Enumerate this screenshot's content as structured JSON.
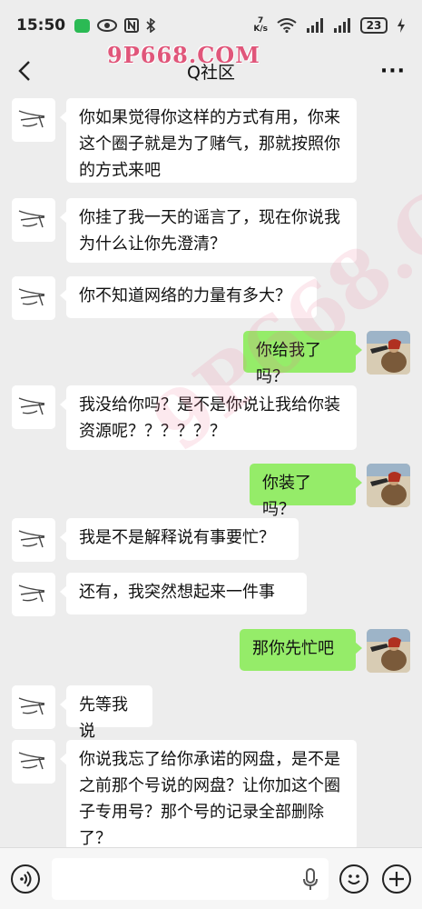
{
  "status_bar": {
    "time": "15:50",
    "net_speed_value": "7",
    "net_speed_unit": "K/s",
    "battery": "23",
    "icons_left": [
      "wechat-icon",
      "eye-icon",
      "nfc-icon",
      "bluetooth-icon"
    ],
    "icons_right": [
      "wifi-icon",
      "signal-icon",
      "signal-icon",
      "battery-icon",
      "charging-icon"
    ]
  },
  "nav": {
    "title": "Q社区",
    "more_label": "···",
    "watermark": "9P668.COM"
  },
  "watermark_diag": "9P668.COM",
  "messages": [
    {
      "side": "left",
      "text": "你如果觉得你这样的方式有用，你来这个圈子就是为了赌气，那就按照你的方式来吧"
    },
    {
      "side": "left",
      "text": "你挂了我一天的谣言了，现在你说我为什么让你先澄清？"
    },
    {
      "side": "left",
      "text": "你不知道网络的力量有多大？"
    },
    {
      "side": "right",
      "text": "你给我了吗？"
    },
    {
      "side": "left",
      "text": "我没给你吗？是不是你说让我给你装资源呢？？？？？？"
    },
    {
      "side": "right",
      "text": "你装了吗？"
    },
    {
      "side": "left",
      "text": "我是不是解释说有事要忙？"
    },
    {
      "side": "left",
      "text": "还有，我突然想起来一件事"
    },
    {
      "side": "right",
      "text": "那你先忙吧"
    },
    {
      "side": "left",
      "text": "先等我说"
    },
    {
      "side": "left",
      "text": "你说我忘了给你承诺的网盘，是不是之前那个号说的网盘？让你加这个圈子专用号？那个号的记录全部删除了？"
    }
  ],
  "input_bar": {
    "placeholder": "",
    "icons": [
      "voice-icon",
      "mic-icon",
      "emoji-icon",
      "plus-icon"
    ]
  },
  "colors": {
    "background": "#ededed",
    "bubble_left": "#ffffff",
    "bubble_right": "#95ec69",
    "watermark": "#e0567a"
  }
}
